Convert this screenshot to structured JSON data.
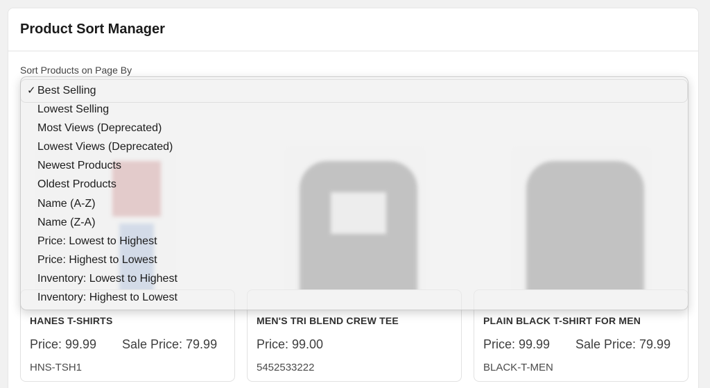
{
  "header": {
    "title": "Product Sort Manager"
  },
  "sort": {
    "label": "Sort Products on Page By",
    "selected": "Best Selling",
    "options": [
      "Best Selling",
      "Lowest Selling",
      "Most Views (Deprecated)",
      "Lowest Views (Deprecated)",
      "Newest Products",
      "Oldest Products",
      "Name (A-Z)",
      "Name (Z-A)",
      "Price: Lowest to Highest",
      "Price: Highest to Lowest",
      "Inventory: Lowest to Highest",
      "Inventory: Highest to Lowest"
    ]
  },
  "products": [
    {
      "name": "HANES T-SHIRTS",
      "price": "Price: 99.99",
      "sale_price": "Sale Price: 79.99",
      "sku": "HNS-TSH1"
    },
    {
      "name": "MEN'S TRI BLEND CREW TEE",
      "price": "Price: 99.00",
      "sale_price": "",
      "sku": "5452533222"
    },
    {
      "name": "PLAIN BLACK T-SHIRT FOR MEN",
      "price": "Price: 99.99",
      "sale_price": "Sale Price: 79.99",
      "sku": "BLACK-T-MEN"
    }
  ],
  "icons": {
    "checkmark": "checkmark-icon"
  },
  "colors": {
    "background": "#f1f1f1",
    "card": "#ffffff",
    "dropdown": "#ececec"
  }
}
